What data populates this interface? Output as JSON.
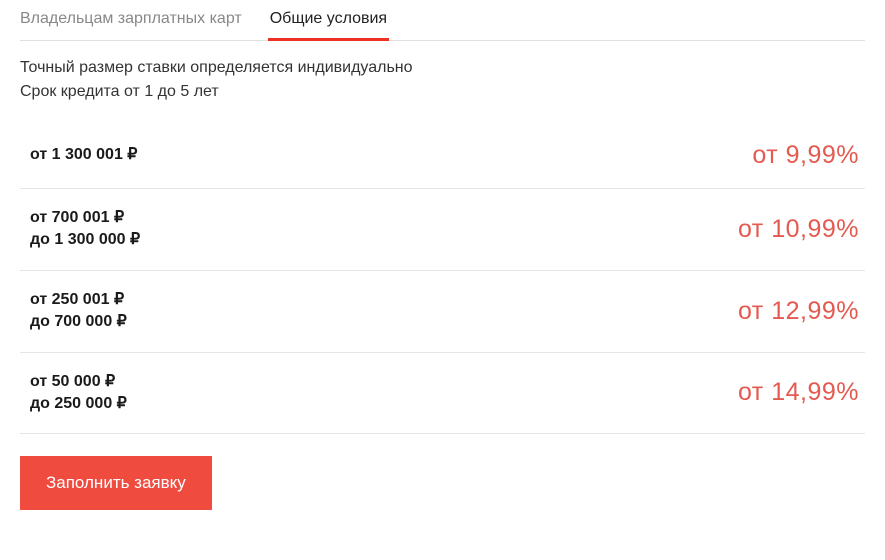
{
  "tabs": {
    "inactive": "Владельцам зарплатных карт",
    "active": "Общие условия"
  },
  "intro": {
    "line1": "Точный размер ставки определяется индивидуально",
    "line2": "Срок кредита от 1 до 5 лет"
  },
  "rows": [
    {
      "range_from": "от 1  300 001 ₽",
      "range_to": "",
      "rate": "от 9,99%"
    },
    {
      "range_from": "от 700 001 ₽",
      "range_to": "до 1 300 000 ₽",
      "rate": "от 10,99%"
    },
    {
      "range_from": "от 250 001 ₽",
      "range_to": "до 700 000 ₽",
      "rate": "от 12,99%"
    },
    {
      "range_from": "от 50 000 ₽",
      "range_to": "до 250 000 ₽",
      "rate": "от 14,99%"
    }
  ],
  "button": {
    "label": "Заполнить заявку"
  }
}
